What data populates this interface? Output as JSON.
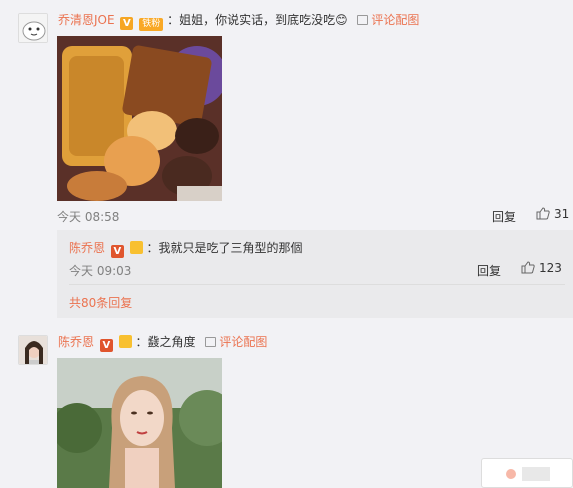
{
  "comment1": {
    "username": "乔清恩JOE",
    "v_badge": "V",
    "fan_tag": "铁粉",
    "text": "：姐姐，你说实话，到底吃没吃😊",
    "pic_link": "评论配图",
    "time": "今天 08:58",
    "reply_label": "回复",
    "like_count": "31"
  },
  "reply1": {
    "username": "陈乔恩",
    "v_badge": "V",
    "text": "：我就只是吃了三角型的那個",
    "time": "今天 09:03",
    "reply_label": "回复",
    "like_count": "123"
  },
  "more_replies": "共80条回复",
  "comment2": {
    "username": "陈乔恩",
    "v_badge": "V",
    "text": "：鼗之角度",
    "pic_link": "评论配图"
  },
  "colors": {
    "accent": "#eb7350",
    "background": "#f2f2f5",
    "reply_box": "#eaeaec"
  }
}
